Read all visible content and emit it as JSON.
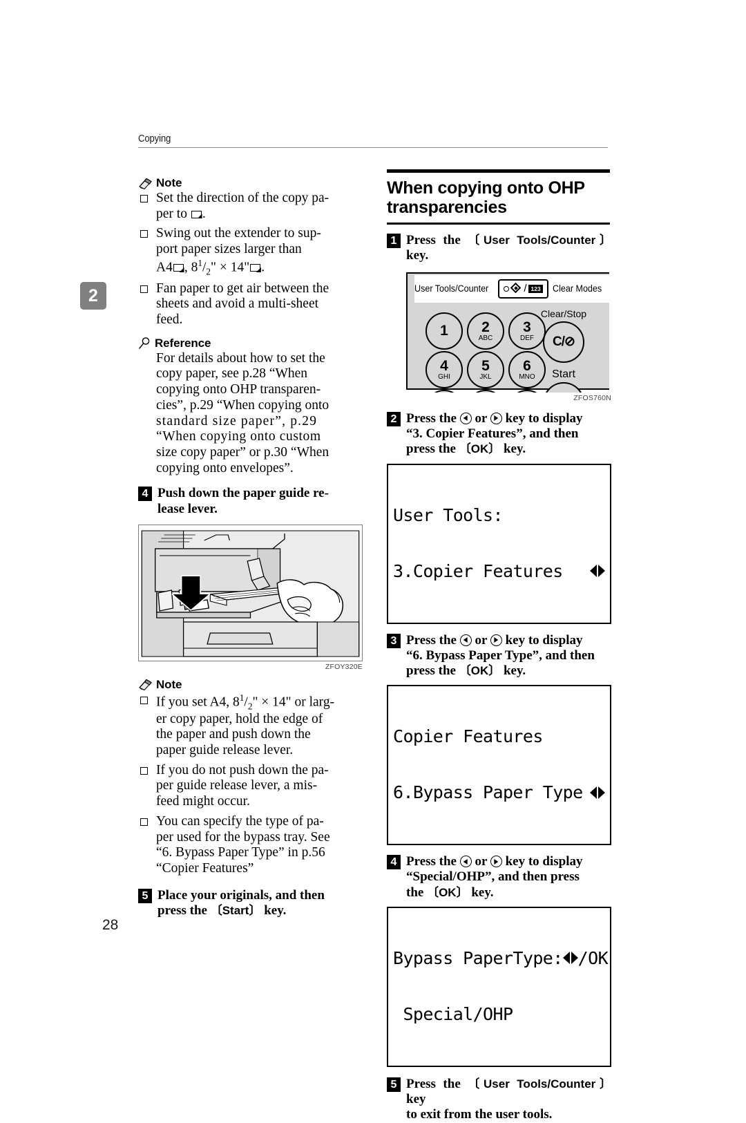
{
  "header": {
    "running_head": "Copying"
  },
  "chapter_tab": {
    "number": "2"
  },
  "folio": {
    "page_number": "28"
  },
  "left_column": {
    "note_top": {
      "label": "Note",
      "icon": "pencil-note-icon",
      "items": [
        {
          "text_a": "Set the direction of the copy pa-",
          "text_b": "per to ",
          "glyph": "landscape-sheet-icon",
          "text_c": "."
        },
        {
          "text_a": "Swing out the extender to sup-",
          "text_b": "port paper sizes larger than",
          "text_c": "A4",
          "text_d": ", 8",
          "sup": "1",
          "frac": "/",
          "sub": "2",
          "text_e": "\" × 14\"",
          "text_f": "."
        },
        {
          "text_a": "Fan paper to get air between the",
          "text_b": "sheets and avoid a multi-sheet",
          "text_c": "feed."
        }
      ]
    },
    "reference": {
      "label": "Reference",
      "icon": "magnifier-reference-icon",
      "body": "For details about how to set the copy paper, see p.28 “When copying onto OHP transparen-cies”, p.29 “When copying onto standard size paper”, p.29 “When copying onto custom size copy paper” or p.30 “When copying onto envelopes”.",
      "lines": [
        "For details about how to set the",
        "copy paper, see p.28 “When",
        "copying onto OHP transparen-",
        "cies”, p.29 “When copying onto",
        "standard size paper”, p.29",
        "“When copying onto custom",
        "size copy paper” or p.30 “When",
        "copying onto envelopes”."
      ]
    },
    "step4": {
      "number": "4",
      "line1": "Push down the paper guide re-",
      "line2": "lease lever."
    },
    "figure_machine": {
      "caption": "ZFOY320E",
      "alt": "bypass tray with hand inserting paper and down arrow"
    },
    "note_bottom": {
      "label": "Note",
      "icon": "pencil-note-icon",
      "items": [
        {
          "lines": [
            "If you set A4, 8¹/₂\" × 14\" or larg-",
            "er copy paper, hold the edge of",
            "the paper and push down the",
            "paper guide release lever."
          ],
          "prefix": "If you set A4, 8",
          "sup": "1",
          "sub": "2",
          "rest": "\" × 14\" or larg-"
        },
        {
          "lines": [
            "If you do not push down the pa-",
            "per guide release lever, a mis-",
            "feed might occur."
          ]
        },
        {
          "lines": [
            "You can specify the type of pa-",
            "per used for the bypass tray. See",
            "“6. Bypass Paper Type” in p.56",
            "“Copier Features”"
          ]
        }
      ]
    },
    "step5": {
      "number": "5",
      "line1": "Place your originals, and then",
      "line2_pre": "press the ",
      "key": "Start",
      "line2_post": " key."
    }
  },
  "right_column": {
    "section_heading": {
      "line1": "When copying onto OHP",
      "line2": "transparencies"
    },
    "step1": {
      "number": "1",
      "pre": "Press the ",
      "key": "User Tools/Counter",
      "post": " key."
    },
    "figure_control_panel": {
      "caption": "ZFOS760N",
      "labels": {
        "user_tools_counter": "User Tools/Counter",
        "clear_modes": "Clear Modes",
        "clear_stop": "Clear/Stop",
        "start": "Start",
        "clear_stop_key": "C/⊘",
        "key_123": "123"
      },
      "keypad": [
        {
          "digit": "1",
          "letters": ""
        },
        {
          "digit": "2",
          "letters": "ABC"
        },
        {
          "digit": "3",
          "letters": "DEF"
        },
        {
          "digit": "4",
          "letters": "GHI"
        },
        {
          "digit": "5",
          "letters": "JKL"
        },
        {
          "digit": "6",
          "letters": "MNO"
        }
      ]
    },
    "step2": {
      "number": "2",
      "pre": "Press the ",
      "mid": " or ",
      "post": " key to display",
      "line2": "“3. Copier Features”, and then",
      "line3_pre": "press the ",
      "key": "OK",
      "line3_post": " key.",
      "lcd": {
        "line1": "User Tools:",
        "line2": "3.Copier Features",
        "arrows": "left-right-arrows-icon"
      }
    },
    "step3": {
      "number": "3",
      "pre": "Press the ",
      "mid": " or ",
      "post": " key to display",
      "line2": "“6. Bypass Paper Type”, and then",
      "line3_pre": "press the ",
      "key": "OK",
      "line3_post": " key.",
      "lcd": {
        "line1": "Copier Features",
        "line2": "6.Bypass Paper Type",
        "arrows": "left-right-arrows-icon"
      }
    },
    "step4": {
      "number": "4",
      "pre": "Press the ",
      "mid": " or ",
      "post": " key to display",
      "line2": "“Special/OHP”, and then press",
      "line3_pre": "the ",
      "key": "OK",
      "line3_post": " key.",
      "lcd": {
        "line1_pre": "Bypass PaperType:",
        "line1_post": "/OK",
        "line2": " Special/OHP",
        "arrows": "left-right-arrows-icon"
      }
    },
    "step5": {
      "number": "5",
      "pre": "Press the ",
      "key": "User Tools/Counter",
      "post": " key",
      "line2": "to exit from the user tools."
    }
  }
}
